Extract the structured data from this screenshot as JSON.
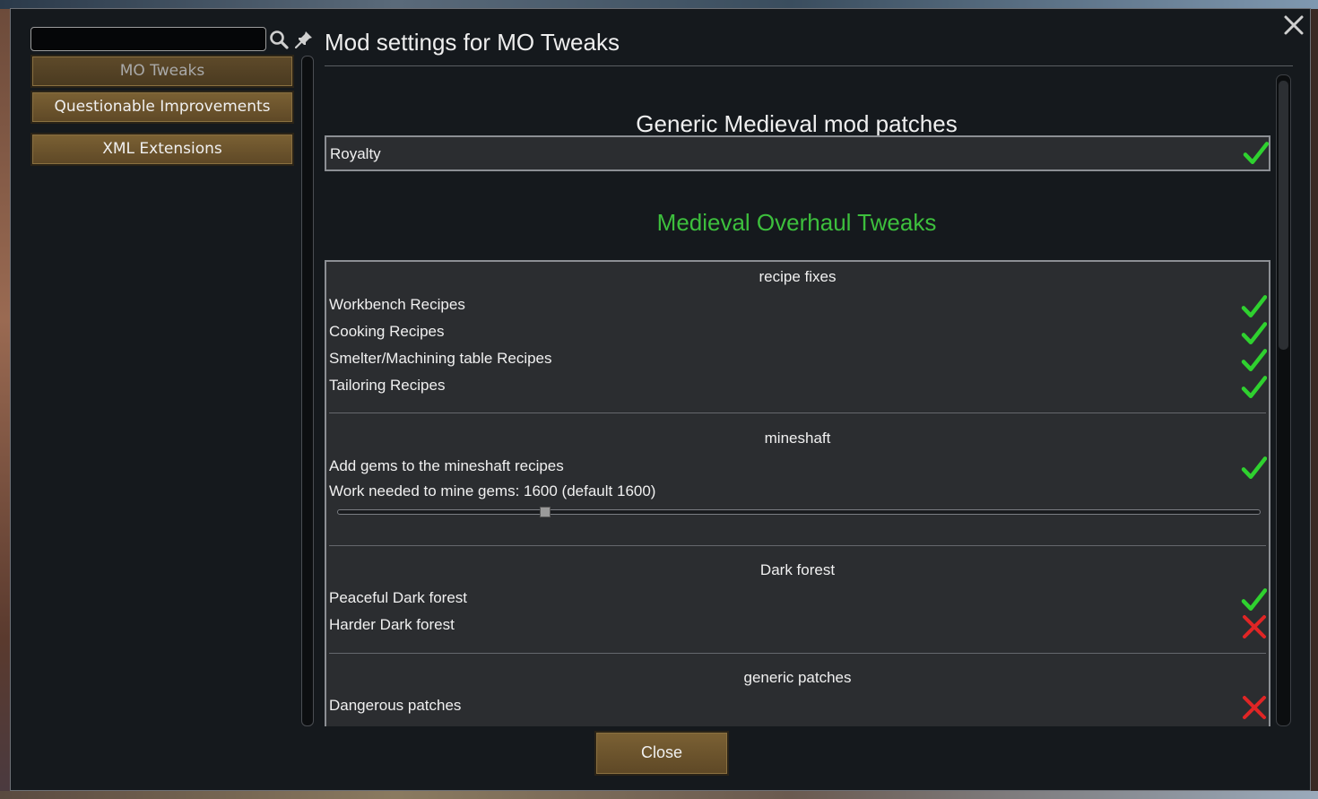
{
  "window": {
    "title": "Mod settings for MO Tweaks",
    "search_value": "",
    "close_label": "Close"
  },
  "mod_list": [
    {
      "label": "MO Tweaks",
      "selected": true
    },
    {
      "label": "Questionable Improvements",
      "selected": false
    },
    {
      "label": "XML Extensions",
      "selected": false
    }
  ],
  "settings": {
    "generic_header": "Generic Medieval mod patches",
    "royalty": {
      "label": "Royalty",
      "enabled": true
    },
    "mo_header": "Medieval Overhaul Tweaks",
    "mo_header_color": "#3dbf3d",
    "groups": {
      "recipe_fixes": {
        "title": "recipe fixes",
        "items": [
          {
            "label": "Workbench Recipes",
            "enabled": true
          },
          {
            "label": "Cooking Recipes",
            "enabled": true
          },
          {
            "label": "Smelter/Machining table Recipes",
            "enabled": true
          },
          {
            "label": "Tailoring Recipes",
            "enabled": true
          }
        ]
      },
      "mineshaft": {
        "title": "mineshaft",
        "gems": {
          "label": "Add gems to the mineshaft recipes",
          "enabled": true
        },
        "work_label": "Work needed to mine gems: 1600 (default 1600)",
        "work_value_fraction": 0.225
      },
      "dark_forest": {
        "title": "Dark forest",
        "items": [
          {
            "label": "Peaceful Dark forest",
            "enabled": true
          },
          {
            "label": "Harder Dark forest",
            "enabled": false
          }
        ]
      },
      "generic_patches": {
        "title": "generic patches",
        "items": [
          {
            "label": "Dangerous patches",
            "enabled": false
          }
        ]
      }
    }
  },
  "colors": {
    "check_on": "#2fd12f",
    "check_off": "#e02525",
    "button_brown": "#6b532d"
  }
}
